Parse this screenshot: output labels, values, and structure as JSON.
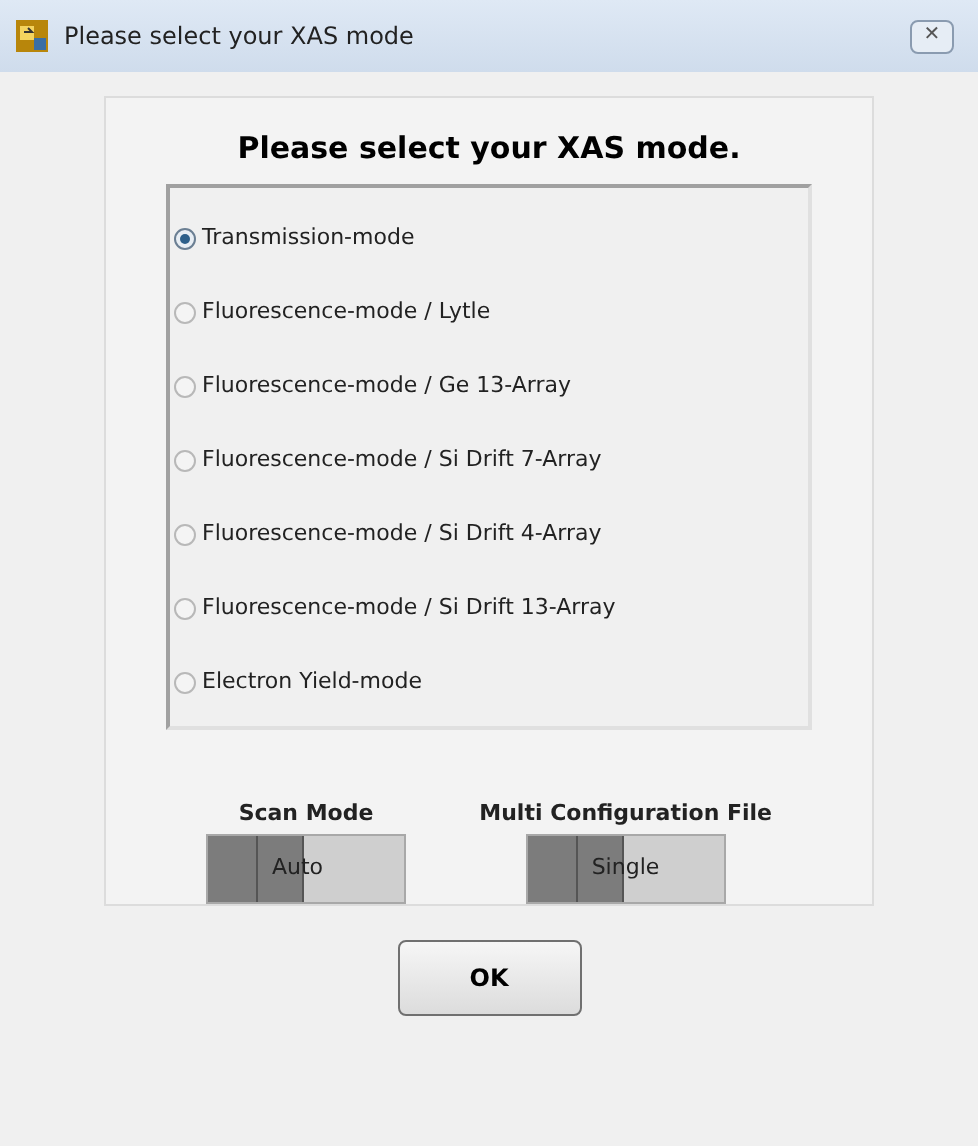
{
  "window": {
    "title": "Please select your XAS mode",
    "close": "✕"
  },
  "heading": "Please select your XAS mode.",
  "modes": [
    {
      "label": "Transmission-mode",
      "selected": true
    },
    {
      "label": "Fluorescence-mode / Lytle",
      "selected": false
    },
    {
      "label": "Fluorescence-mode / Ge 13-Array",
      "selected": false
    },
    {
      "label": "Fluorescence-mode / Si Drift 7-Array",
      "selected": false
    },
    {
      "label": "Fluorescence-mode / Si Drift 4-Array",
      "selected": false
    },
    {
      "label": "Fluorescence-mode / Si Drift 13-Array",
      "selected": false
    },
    {
      "label": "Electron Yield-mode",
      "selected": false
    }
  ],
  "switches": [
    {
      "label": "Scan Mode",
      "value": "Auto",
      "on": false
    },
    {
      "label": "Multi Configuration File",
      "value": "Single",
      "on": false
    }
  ],
  "ok_button": "OK"
}
